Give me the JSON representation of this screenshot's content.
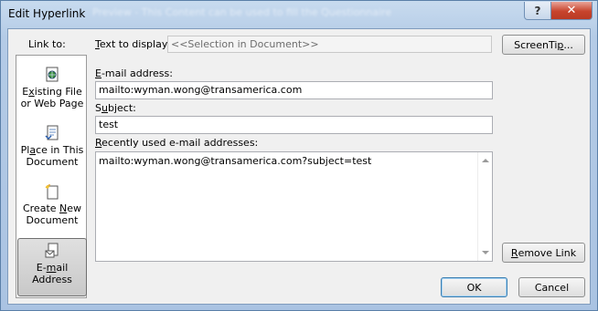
{
  "window": {
    "title": "Edit Hyperlink",
    "ghost_text": "Preview - This Content can be used to fill the Questionnaire",
    "help_label": "?",
    "close_label": "✕"
  },
  "link_to": {
    "heading": "Link to:",
    "items": [
      {
        "line1_pre": "E",
        "line1_ul": "x",
        "line1_post": "isting File",
        "line2": "or Web Page",
        "icon": "web-page-icon"
      },
      {
        "line1_pre": "Pl",
        "line1_ul": "a",
        "line1_post": "ce in This",
        "line2": "Document",
        "icon": "place-in-document-icon"
      },
      {
        "line1_pre": "Create ",
        "line1_ul": "N",
        "line1_post": "ew",
        "line2": "Document",
        "icon": "new-document-icon"
      },
      {
        "line1_pre": "E-",
        "line1_ul": "m",
        "line1_post": "ail",
        "line2": "Address",
        "icon": "email-address-icon",
        "selected": true
      }
    ]
  },
  "text_to_display": {
    "label_ul": "T",
    "label_rest": "ext to display:",
    "value": "<<Selection in Document>>"
  },
  "screentip_button": {
    "pre": "ScreenTi",
    "ul": "p",
    "post": "..."
  },
  "email": {
    "label_ul": "E",
    "label_rest": "-mail address:",
    "value": "mailto:wyman.wong@transamerica.com"
  },
  "subject": {
    "label_pre": "S",
    "label_ul": "u",
    "label_rest": "bject:",
    "value": "test"
  },
  "recent": {
    "label_ul": "R",
    "label_rest": "ecently used e-mail addresses:",
    "items": [
      "mailto:wyman.wong@transamerica.com?subject=test"
    ]
  },
  "remove_link_button": {
    "ul": "R",
    "rest": "emove Link"
  },
  "ok_button": "OK",
  "cancel_button": "Cancel"
}
